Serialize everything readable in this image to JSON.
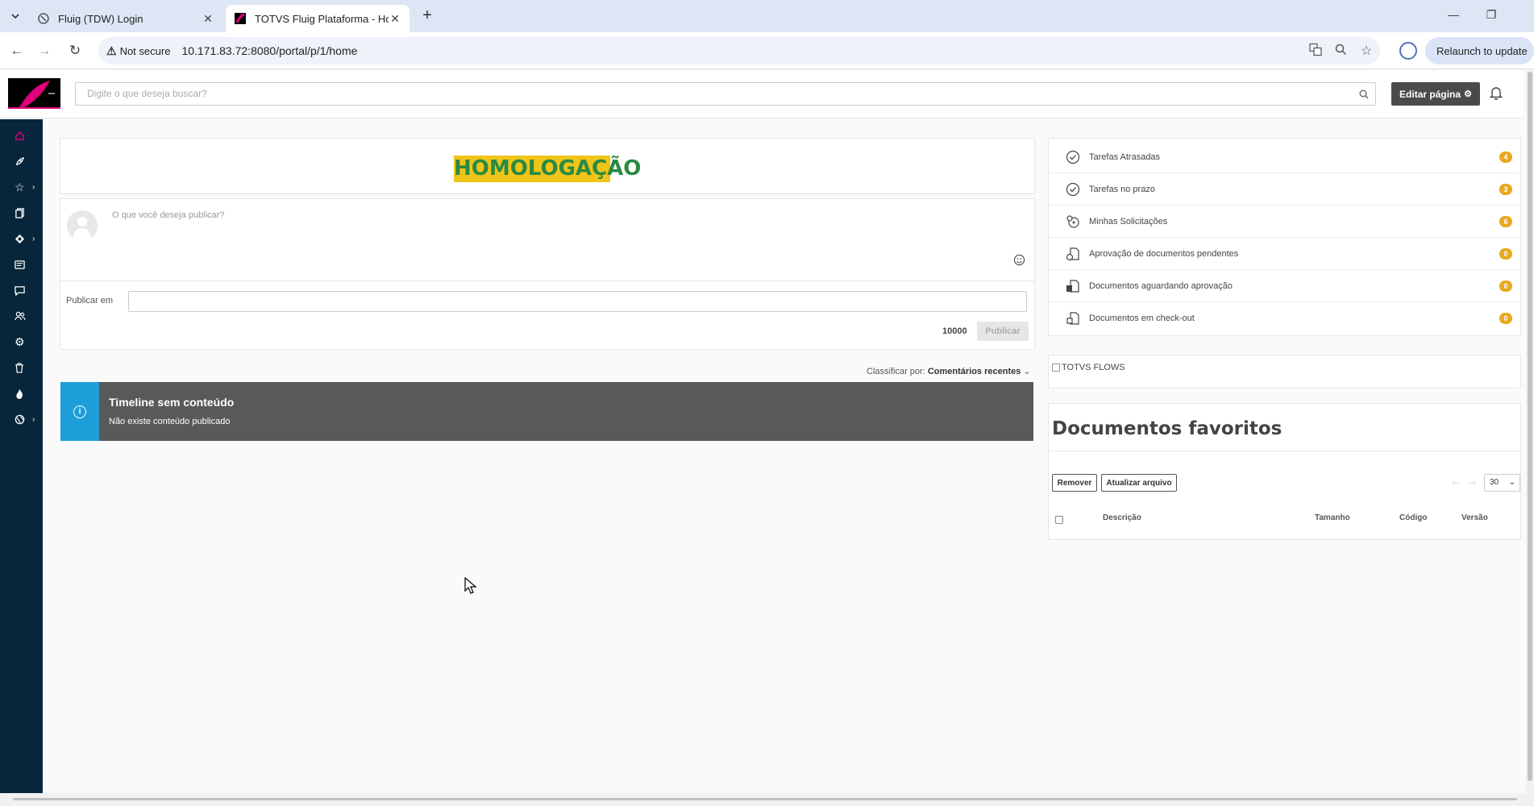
{
  "browser": {
    "tabs": [
      {
        "title": "Fluig (TDW)  Login",
        "active": false
      },
      {
        "title": "TOTVS Fluig Plataforma - Home",
        "active": true
      }
    ],
    "security_label": "Not secure",
    "url": "10.171.83.72:8080/portal/p/1/home",
    "relaunch_label": "Relaunch to update"
  },
  "header": {
    "search_placeholder": "Digite o que deseja buscar?",
    "edit_page_label": "Editar página"
  },
  "sidebar": {
    "items": [
      {
        "icon": "home-icon",
        "active": true,
        "has_submenu": false
      },
      {
        "icon": "rocket-icon",
        "active": false,
        "has_submenu": false
      },
      {
        "icon": "star-icon",
        "active": false,
        "has_submenu": true
      },
      {
        "icon": "documents-icon",
        "active": false,
        "has_submenu": false
      },
      {
        "icon": "process-icon",
        "active": false,
        "has_submenu": true
      },
      {
        "icon": "news-icon",
        "active": false,
        "has_submenu": false
      },
      {
        "icon": "chat-icon",
        "active": false,
        "has_submenu": false
      },
      {
        "icon": "people-icon",
        "active": false,
        "has_submenu": false
      },
      {
        "icon": "settings-icon",
        "active": false,
        "has_submenu": false
      },
      {
        "icon": "trash-icon",
        "active": false,
        "has_submenu": false
      },
      {
        "icon": "flame-icon",
        "active": false,
        "has_submenu": false
      },
      {
        "icon": "globe-icon",
        "active": false,
        "has_submenu": true
      }
    ]
  },
  "banner": {
    "label": "HOMOLOGAÇÃO"
  },
  "publish": {
    "placeholder": "O que você deseja publicar?",
    "publish_in_label": "Publicar em",
    "char_counter": "10000",
    "publish_button": "Publicar"
  },
  "sort": {
    "label": "Classificar por:",
    "value": "Comentários recentes"
  },
  "timeline": {
    "title": "Timeline sem conteúdo",
    "subtitle": "Não existe conteúdo publicado"
  },
  "tasks": [
    {
      "label": "Tarefas Atrasadas",
      "count": "4",
      "icon": "clock-check-icon"
    },
    {
      "label": "Tarefas no prazo",
      "count": "3",
      "icon": "clock-check-icon"
    },
    {
      "label": "Minhas Solicitações",
      "count": "6",
      "icon": "request-icon"
    },
    {
      "label": "Aprovação de documentos pendentes",
      "count": "0",
      "icon": "document-clock-icon"
    },
    {
      "label": "Documentos aguardando aprovação",
      "count": "0",
      "icon": "document-wait-icon"
    },
    {
      "label": "Documentos em check-out",
      "count": "0",
      "icon": "document-checkout-icon"
    }
  ],
  "flows": {
    "image_alt": "TOTVS FLOWS"
  },
  "favorites": {
    "title": "Documentos favoritos",
    "remove_button": "Remover",
    "update_button": "Atualizar arquivo",
    "page_size": "30",
    "columns": {
      "description": "Descrição",
      "size": "Tamanho",
      "code": "Código",
      "version": "Versão"
    }
  },
  "colors": {
    "sidebar_bg": "#07263b",
    "accent": "#e0007a",
    "banner_bg": "#f0c419",
    "banner_text": "#2a8a41",
    "timeline_bg": "#58595b",
    "timeline_icon_bg": "#1e9ed9",
    "badge": "#e8a81f"
  }
}
